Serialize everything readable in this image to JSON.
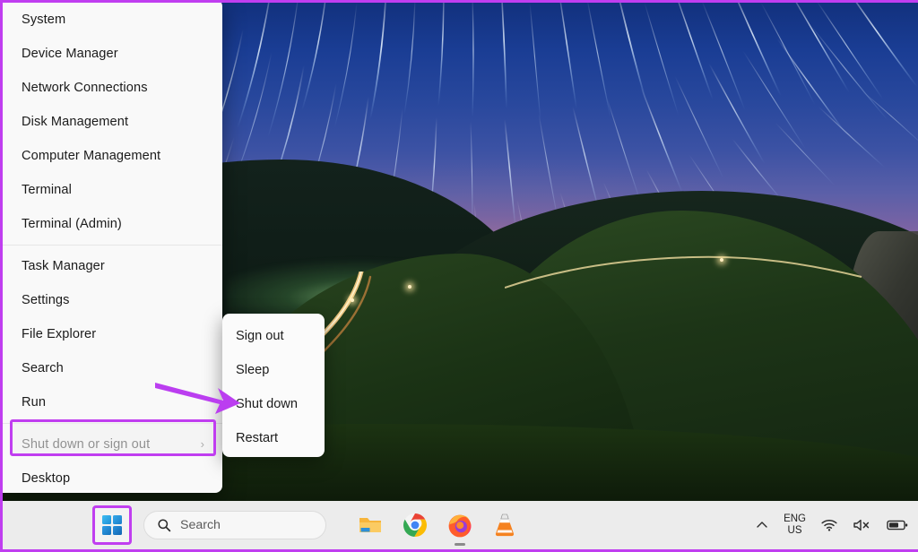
{
  "desktop": {
    "wallpaper_description": "Night sky star trails over forested mountain with winding road light trail",
    "sky_top_color": "#12317e",
    "sky_horizon_color": "#c79189"
  },
  "annotation": {
    "accent_color": "#c03ef0",
    "arrow_target": "Shut down",
    "screenshot_border_color": "#c03ef0"
  },
  "context_menu": {
    "name": "Win+X Power User Menu",
    "groups": [
      {
        "items": [
          {
            "label": "System",
            "has_submenu": false
          },
          {
            "label": "Device Manager",
            "has_submenu": false
          },
          {
            "label": "Network Connections",
            "has_submenu": false
          },
          {
            "label": "Disk Management",
            "has_submenu": false
          },
          {
            "label": "Computer Management",
            "has_submenu": false
          },
          {
            "label": "Terminal",
            "has_submenu": false
          },
          {
            "label": "Terminal (Admin)",
            "has_submenu": false
          }
        ]
      },
      {
        "items": [
          {
            "label": "Task Manager",
            "has_submenu": false
          },
          {
            "label": "Settings",
            "has_submenu": false
          },
          {
            "label": "File Explorer",
            "has_submenu": false
          },
          {
            "label": "Search",
            "has_submenu": false
          },
          {
            "label": "Run",
            "has_submenu": false
          }
        ]
      },
      {
        "items": [
          {
            "label": "Shut down or sign out",
            "has_submenu": true,
            "chevron": "›",
            "highlighted": true
          },
          {
            "label": "Desktop",
            "has_submenu": false
          }
        ]
      }
    ]
  },
  "submenu": {
    "parent": "Shut down or sign out",
    "items": [
      {
        "label": "Sign out"
      },
      {
        "label": "Sleep"
      },
      {
        "label": "Shut down",
        "pointed_at": true
      },
      {
        "label": "Restart"
      }
    ]
  },
  "taskbar": {
    "start_button": {
      "name": "Start",
      "highlighted": true
    },
    "search": {
      "placeholder": "Search",
      "value": "",
      "icon": "search-icon"
    },
    "apps": [
      {
        "name": "File Explorer",
        "icon": "folder-icon",
        "running": false
      },
      {
        "name": "Google Chrome",
        "icon": "chrome-icon",
        "running": false
      },
      {
        "name": "Mozilla Firefox",
        "icon": "firefox-icon",
        "running": true
      },
      {
        "name": "VLC media player",
        "icon": "vlc-cone-icon",
        "running": false
      }
    ],
    "tray": {
      "overflow_chevron": "∧",
      "language_line1": "ENG",
      "language_line2": "US",
      "wifi": "wifi-icon",
      "volume": "speaker-muted-icon",
      "battery": "battery-icon"
    }
  }
}
